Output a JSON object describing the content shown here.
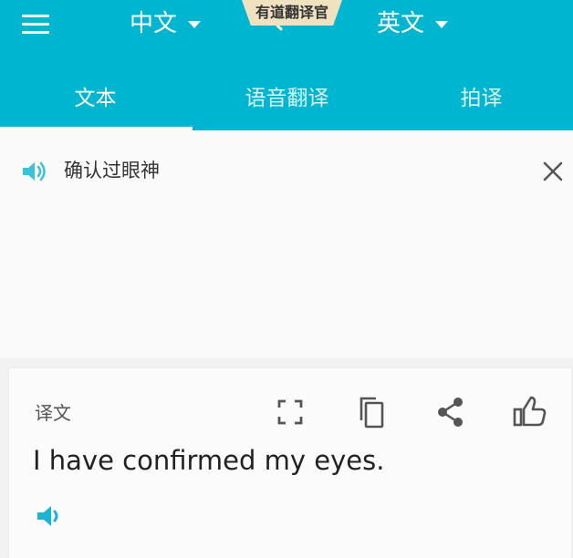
{
  "header": {
    "source_lang": "中文",
    "target_lang": "英文",
    "brand": "有道翻译官"
  },
  "tabs": [
    {
      "label": "文本",
      "active": true
    },
    {
      "label": "语音翻译",
      "active": false
    },
    {
      "label": "拍译",
      "active": false
    }
  ],
  "input": {
    "value": "确认过眼神"
  },
  "result": {
    "label": "译文",
    "text": "I have confirmed my eyes."
  },
  "colors": {
    "accent": "#00b5cf",
    "banner": "#f0e2c0"
  },
  "icons": [
    "menu-icon",
    "chevron-down-icon",
    "swap-icon",
    "speaker-icon",
    "close-icon",
    "fullscreen-icon",
    "copy-icon",
    "share-icon",
    "thumbs-up-icon"
  ]
}
